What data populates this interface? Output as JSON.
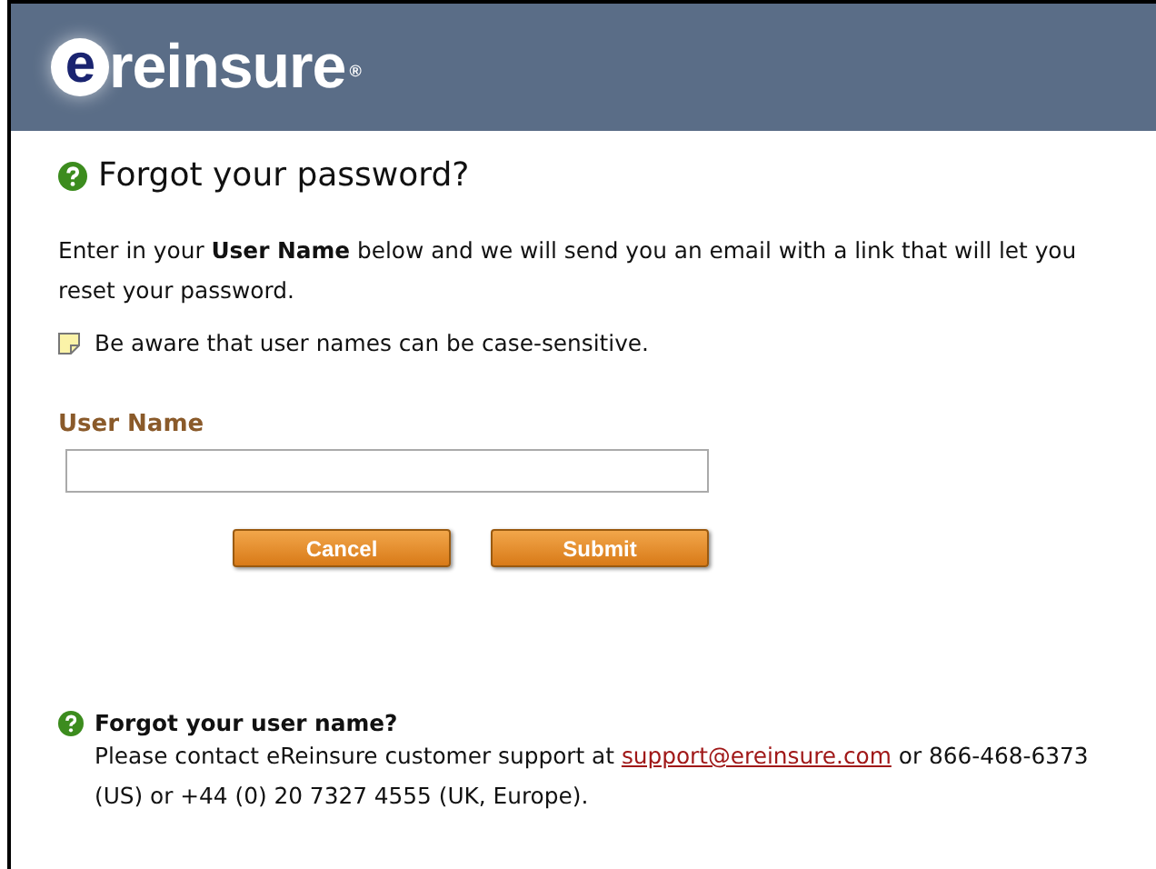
{
  "header": {
    "logo_mark": "e",
    "logo_text": "reinsure",
    "registered": "®"
  },
  "title": "Forgot your password?",
  "intro": "Enter in your **User Name** below and we will send you an email with a link that will let you reset your password.",
  "note": "Be aware that user names can be case-sensitive.",
  "field": {
    "label": "User Name"
  },
  "buttons": [
    "Cancel",
    "Submit"
  ],
  "help": {
    "title": "Forgot your user name?",
    "text_before": "Please contact eReinsure customer support at ",
    "link": "support@ereinsure.com",
    "text_after": " or 866-468-6373 (US) or +44 (0) 20 7327 4555 (UK, Europe)."
  }
}
